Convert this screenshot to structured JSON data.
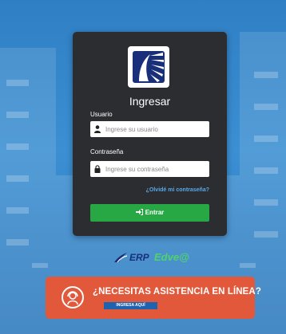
{
  "login": {
    "title": "Ingresar",
    "username_label": "Usuario",
    "username_placeholder": "Ingrese su usuario",
    "password_label": "Contraseña",
    "password_placeholder": "Ingrese su contraseña",
    "forgot_link": "¿Olvidé mi contraseña?",
    "submit_label": "Entrar"
  },
  "brand": {
    "erp_text": "ERP",
    "product_text": "Edve@"
  },
  "support_banner": {
    "headline": "¿NECESITAS ASISTENCIA EN LÍNEA?",
    "cta_label": "INGRESA AQUÍ"
  },
  "colors": {
    "card": "#2b2d30",
    "submit": "#28a745",
    "link": "#59a9ea",
    "banner": "#e2583a",
    "cta": "#1e63b0",
    "background": "#2f7fc4"
  }
}
